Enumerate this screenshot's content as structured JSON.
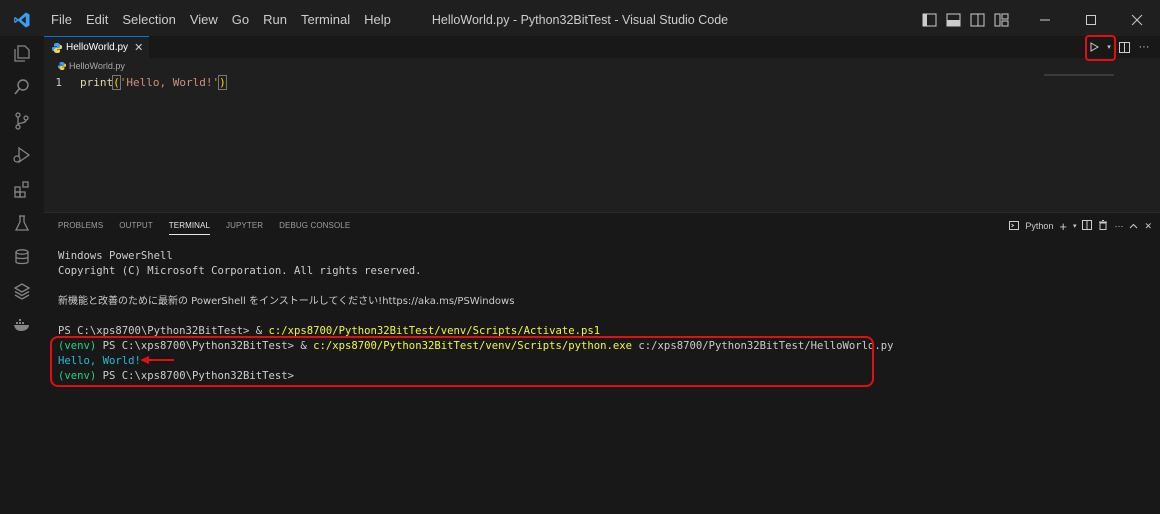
{
  "titlebar": {
    "menu": [
      "File",
      "Edit",
      "Selection",
      "View",
      "Go",
      "Run",
      "Terminal",
      "Help"
    ],
    "window_title": "HelloWorld.py - Python32BitTest - Visual Studio Code"
  },
  "editor": {
    "tab_label": "HelloWorld.py",
    "breadcrumb": "HelloWorld.py",
    "line_number": "1",
    "code": {
      "fn": "print",
      "open": "(",
      "str": "'Hello, World!'",
      "close": ")"
    }
  },
  "panel": {
    "tabs": [
      "PROBLEMS",
      "OUTPUT",
      "TERMINAL",
      "JUPYTER",
      "DEBUG CONSOLE"
    ],
    "active_tab": "TERMINAL",
    "terminal_profile": "Python"
  },
  "terminal": {
    "l1": "Windows PowerShell",
    "l2": "Copyright (C) Microsoft Corporation. All rights reserved.",
    "l3": "新機能と改善のために最新の PowerShell をインストールしてください!https://aka.ms/PSWindows",
    "l4_prompt": "PS C:\\xps8700\\Python32BitTest> & ",
    "l4_path": "c:/xps8700/Python32BitTest/venv/Scripts/Activate.ps1",
    "l5_venv": "(venv) ",
    "l5_prompt": "PS C:\\xps8700\\Python32BitTest> & ",
    "l5_path": "c:/xps8700/Python32BitTest/venv/Scripts/python.exe",
    "l5_arg": " c:/xps8700/Python32BitTest/HelloWorld.py",
    "l6": "Hello, World!",
    "l7_venv": "(venv) ",
    "l7_prompt": "PS C:\\xps8700\\Python32BitTest>"
  },
  "colors": {
    "accent": "#0078d4",
    "highlight": "#e01010"
  }
}
